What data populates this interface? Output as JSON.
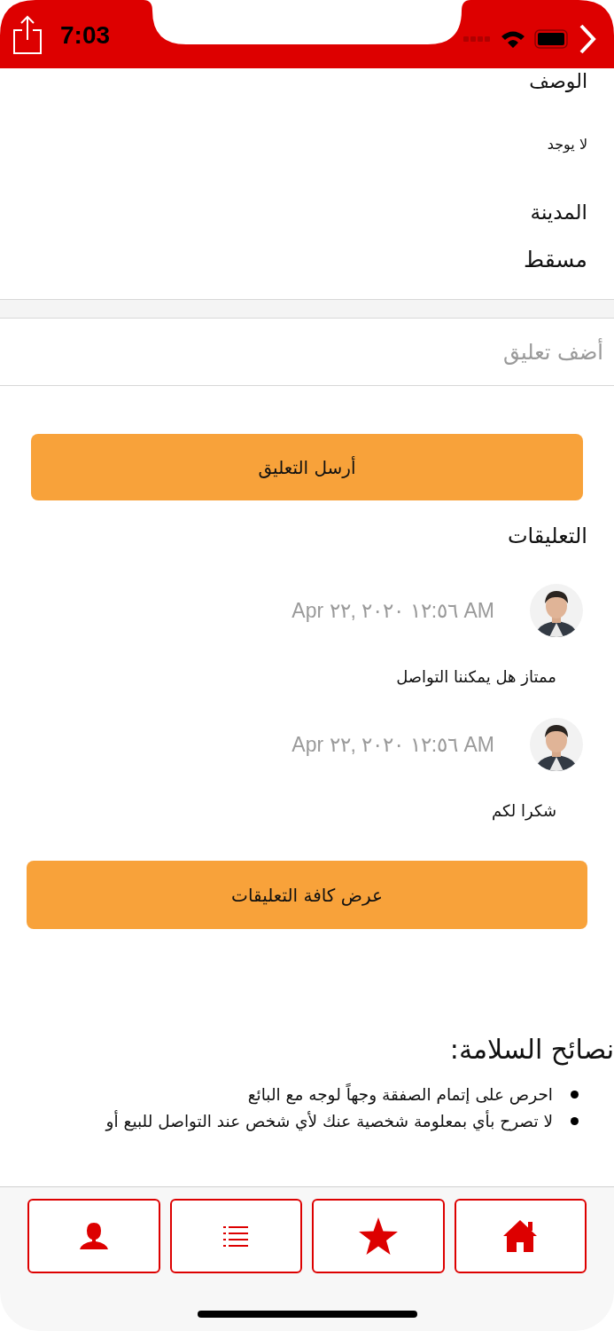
{
  "status_bar": {
    "time": "7:03"
  },
  "description": {
    "label": "الوصف",
    "value": "لا يوجد"
  },
  "city": {
    "label": "المدينة",
    "value": "مسقط"
  },
  "comment_form": {
    "placeholder": "أضف تعليق",
    "submit": "أرسل التعليق"
  },
  "comments": {
    "title": "التعليقات",
    "items": [
      {
        "date": "Apr ٢٢, ٢٠٢٠ ١٢:٥٦ AM",
        "text": "ممتاز هل يمكننا التواصل"
      },
      {
        "date": "Apr ٢٢, ٢٠٢٠ ١٢:٥٦ AM",
        "text": "شكرا لكم"
      }
    ],
    "show_all": "عرض كافة التعليقات"
  },
  "safety": {
    "title": "نصائح السلامة:",
    "tips": [
      "احرص على إتمام الصفقة وجهاً لوجه مع البائع",
      "لا تصرح بأي بمعلومة شخصية عنك لأي شخص عند التواصل للبيع أو"
    ]
  },
  "tab_bar": [
    {
      "kind": "profile"
    },
    {
      "kind": "list"
    },
    {
      "kind": "favorites"
    },
    {
      "kind": "home"
    }
  ]
}
